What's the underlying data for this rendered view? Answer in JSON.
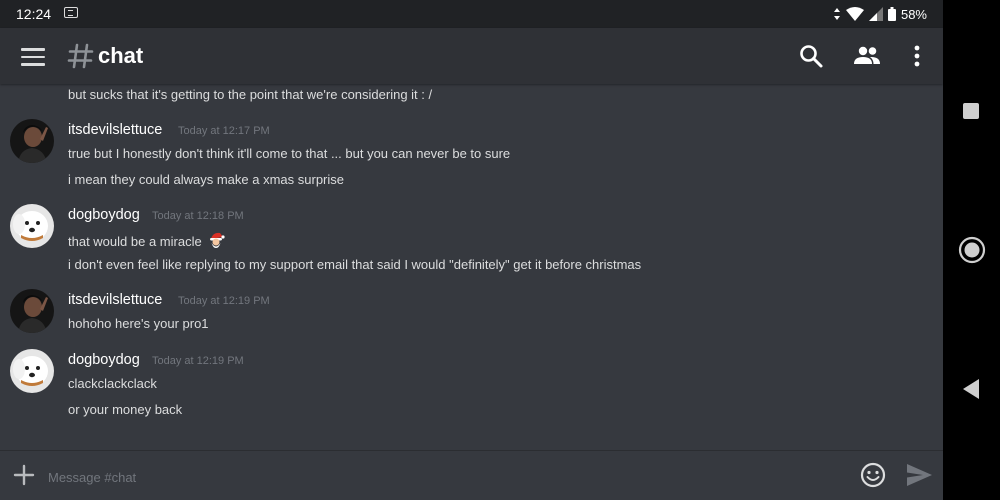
{
  "status_bar": {
    "time": "12:24",
    "battery": "58%",
    "icons": [
      "notification-icon",
      "data-arrows-icon",
      "wifi-icon",
      "signal-icon",
      "battery-icon"
    ]
  },
  "header": {
    "channel": "chat",
    "icons": [
      "menu-icon",
      "hash-icon",
      "search-icon",
      "members-icon",
      "more-vertical-icon"
    ]
  },
  "messages": {
    "partial_line": "but sucks that it's getting to the point that we're considering it : /",
    "groups": [
      {
        "author": "itsdevilslettuce",
        "timestamp": "Today at 12:17 PM",
        "lines": [
          "true but I honestly don't think it'll come to that ... but you can never be to sure",
          "i mean they could always make a xmas surprise"
        ]
      },
      {
        "author": "dogboydog",
        "timestamp": "Today at 12:18 PM",
        "lines": [
          "that would be a miracle",
          "i don't even feel like replying to my support email that said I would \"definitely\" get it before christmas"
        ]
      },
      {
        "author": "itsdevilslettuce",
        "timestamp": "Today at 12:19 PM",
        "lines": [
          "hohoho here's your pro1"
        ]
      },
      {
        "author": "dogboydog",
        "timestamp": "Today at 12:19 PM",
        "lines": [
          "clackclackclack",
          "or your money back"
        ]
      }
    ]
  },
  "composer": {
    "placeholder": "Message #chat",
    "icons": [
      "plus-icon",
      "emoji-icon",
      "send-icon"
    ]
  },
  "colors": {
    "background": "#36393f",
    "header": "#2f3136",
    "text": "#dcddde",
    "muted": "#72767d"
  }
}
